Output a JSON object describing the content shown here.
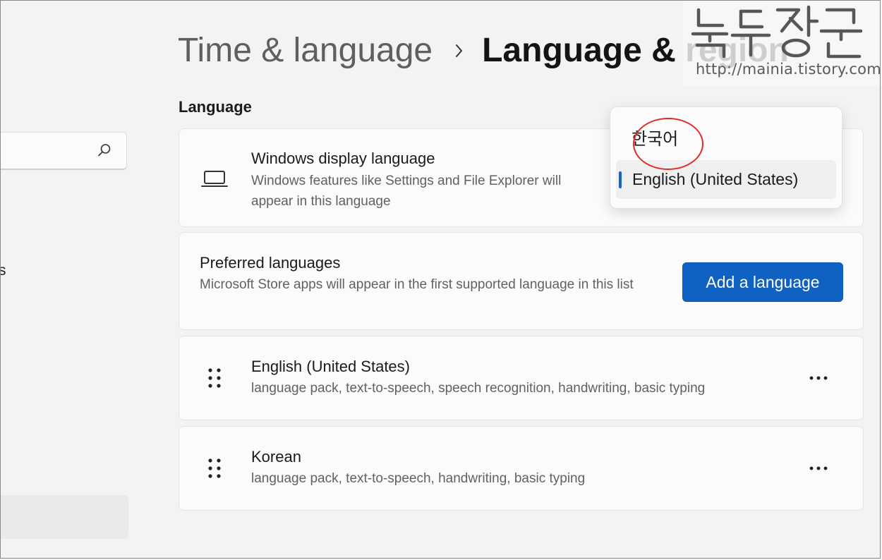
{
  "header": {
    "breadcrumb_parent": "Time & language",
    "breadcrumb_separator": "›",
    "breadcrumb_current": "Language & region"
  },
  "sidebar": {
    "search_placeholder": "",
    "partial_item_text": "s"
  },
  "watermark": {
    "logo_text": "녹두장군",
    "url": "http://mainia.tistory.com"
  },
  "language_section": {
    "title": "Language",
    "display_language": {
      "title": "Windows display language",
      "description": "Windows features like Settings and File Explorer will appear in this language",
      "dropdown_options": [
        "한국어",
        "English (United States)"
      ],
      "selected": "English (United States)"
    },
    "preferred": {
      "title": "Preferred languages",
      "description": "Microsoft Store apps will appear in the first supported language in this list",
      "add_button": "Add a language"
    },
    "languages": [
      {
        "name": "English (United States)",
        "features": "language pack, text-to-speech, speech recognition, handwriting, basic typing"
      },
      {
        "name": "Korean",
        "features": "language pack, text-to-speech, handwriting, basic typing"
      }
    ]
  },
  "colors": {
    "accent": "#0f62c2",
    "highlight_annotation": "#e32a2a",
    "background": "#f3f3f3",
    "card": "#fbfbfb"
  },
  "icons": {
    "search": "search-icon",
    "display": "laptop-icon",
    "reorder": "drag-handle-icon",
    "more": "more-options-icon"
  }
}
